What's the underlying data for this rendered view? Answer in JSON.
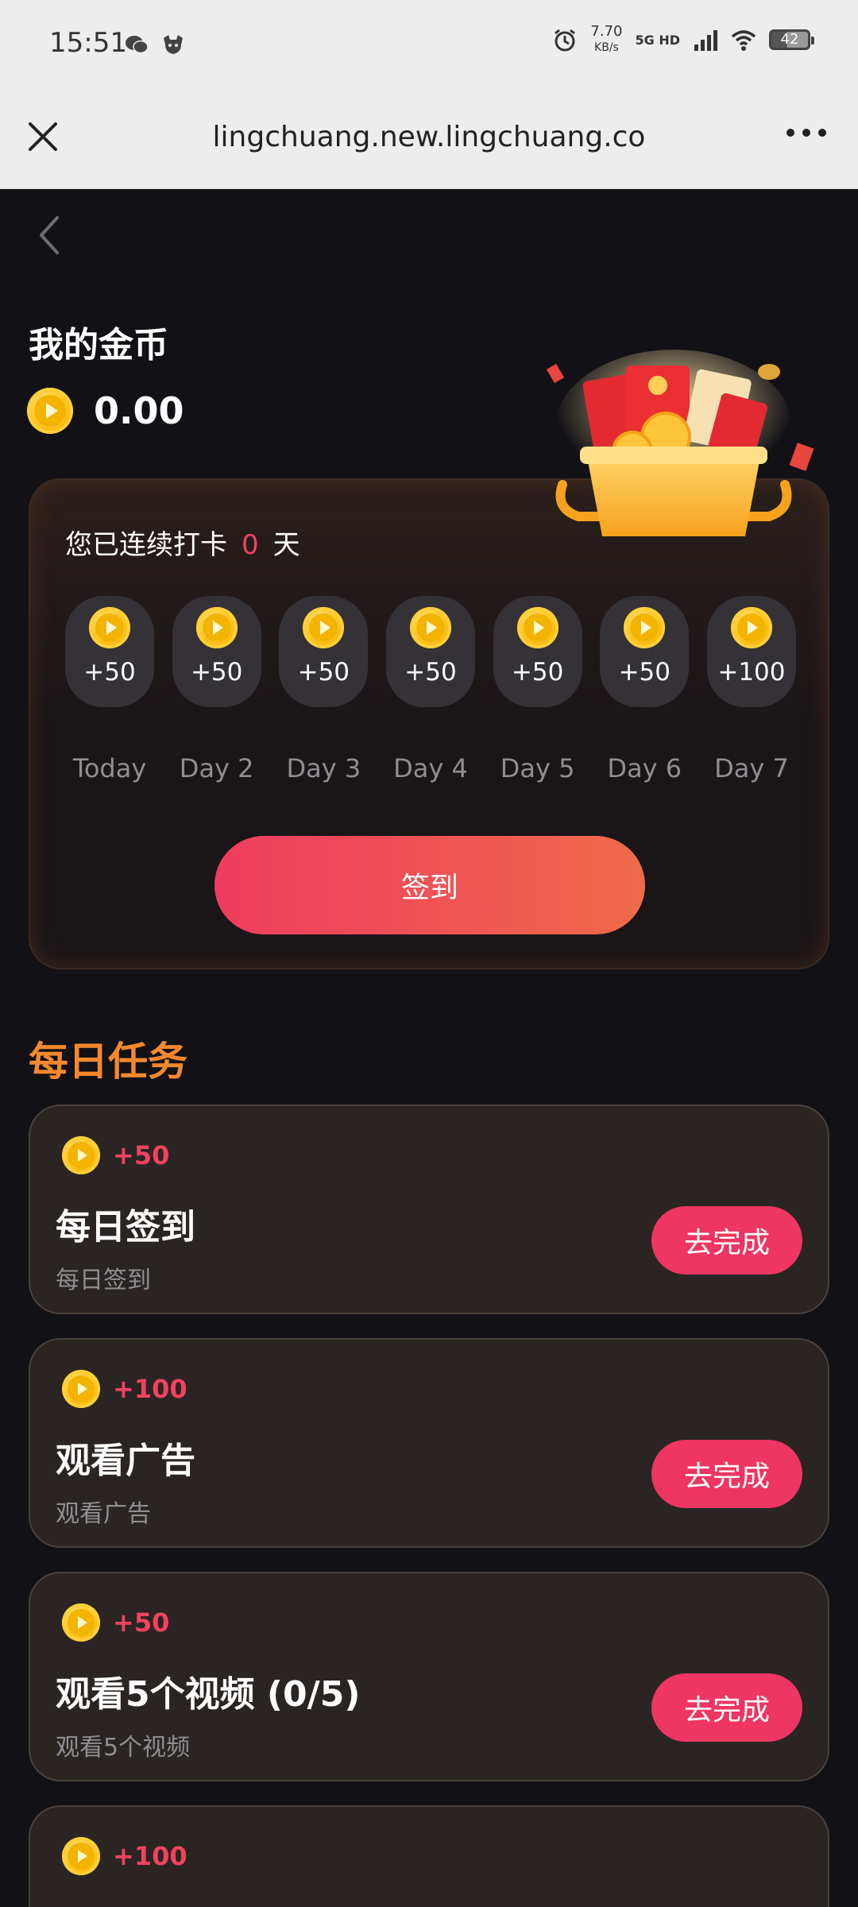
{
  "status_bar": {
    "time": "15:51",
    "net_speed_value": "7.70",
    "net_speed_unit": "KB/s",
    "net_type": "5G HD",
    "battery": "42"
  },
  "browser": {
    "url": "lingchuang.new.lingchuang.co"
  },
  "wallet": {
    "title": "我的金币",
    "balance": "0.00"
  },
  "checkin": {
    "streak_prefix": "您已连续打卡",
    "streak_days": "0",
    "streak_suffix": "天",
    "days": [
      {
        "amount": "+50",
        "label": "Today"
      },
      {
        "amount": "+50",
        "label": "Day 2"
      },
      {
        "amount": "+50",
        "label": "Day 3"
      },
      {
        "amount": "+50",
        "label": "Day 4"
      },
      {
        "amount": "+50",
        "label": "Day 5"
      },
      {
        "amount": "+50",
        "label": "Day 6"
      },
      {
        "amount": "+100",
        "label": "Day 7"
      }
    ],
    "button_label": "签到"
  },
  "tasks": {
    "title": "每日任务",
    "items": [
      {
        "reward": "+50",
        "name": "每日签到",
        "desc": "每日签到",
        "button": "去完成"
      },
      {
        "reward": "+100",
        "name": "观看广告",
        "desc": "观看广告",
        "button": "去完成"
      },
      {
        "reward": "+50",
        "name": "观看5个视频 (0/5)",
        "desc": "观看5个视频",
        "button": "去完成"
      },
      {
        "reward": "+100",
        "name": "",
        "desc": "",
        "button": ""
      }
    ]
  },
  "colors": {
    "accent_red": "#ef3561",
    "task_title_orange": "#f5882e",
    "background": "#121116"
  }
}
